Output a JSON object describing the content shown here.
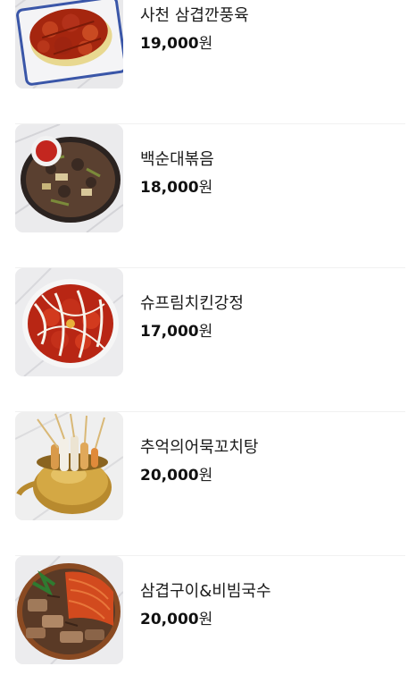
{
  "currency_unit": "원",
  "menu": {
    "items": [
      {
        "name": "사천 삼겹깐풍육",
        "price": "19,000",
        "image_label": "sichuan-pork-belly-photo"
      },
      {
        "name": "백순대볶음",
        "price": "18,000",
        "image_label": "stir-fried-sundae-photo"
      },
      {
        "name": "슈프림치킨강정",
        "price": "17,000",
        "image_label": "supreme-chicken-gangjeong-photo"
      },
      {
        "name": "추억의어묵꼬치탕",
        "price": "20,000",
        "image_label": "fishcake-skewer-soup-photo"
      },
      {
        "name": "삼겹구이&비빔국수",
        "price": "20,000",
        "image_label": "grilled-pork-bibim-noodles-photo"
      }
    ]
  },
  "colors": {
    "divider": "#f1f1f1",
    "price_text": "#111111"
  }
}
